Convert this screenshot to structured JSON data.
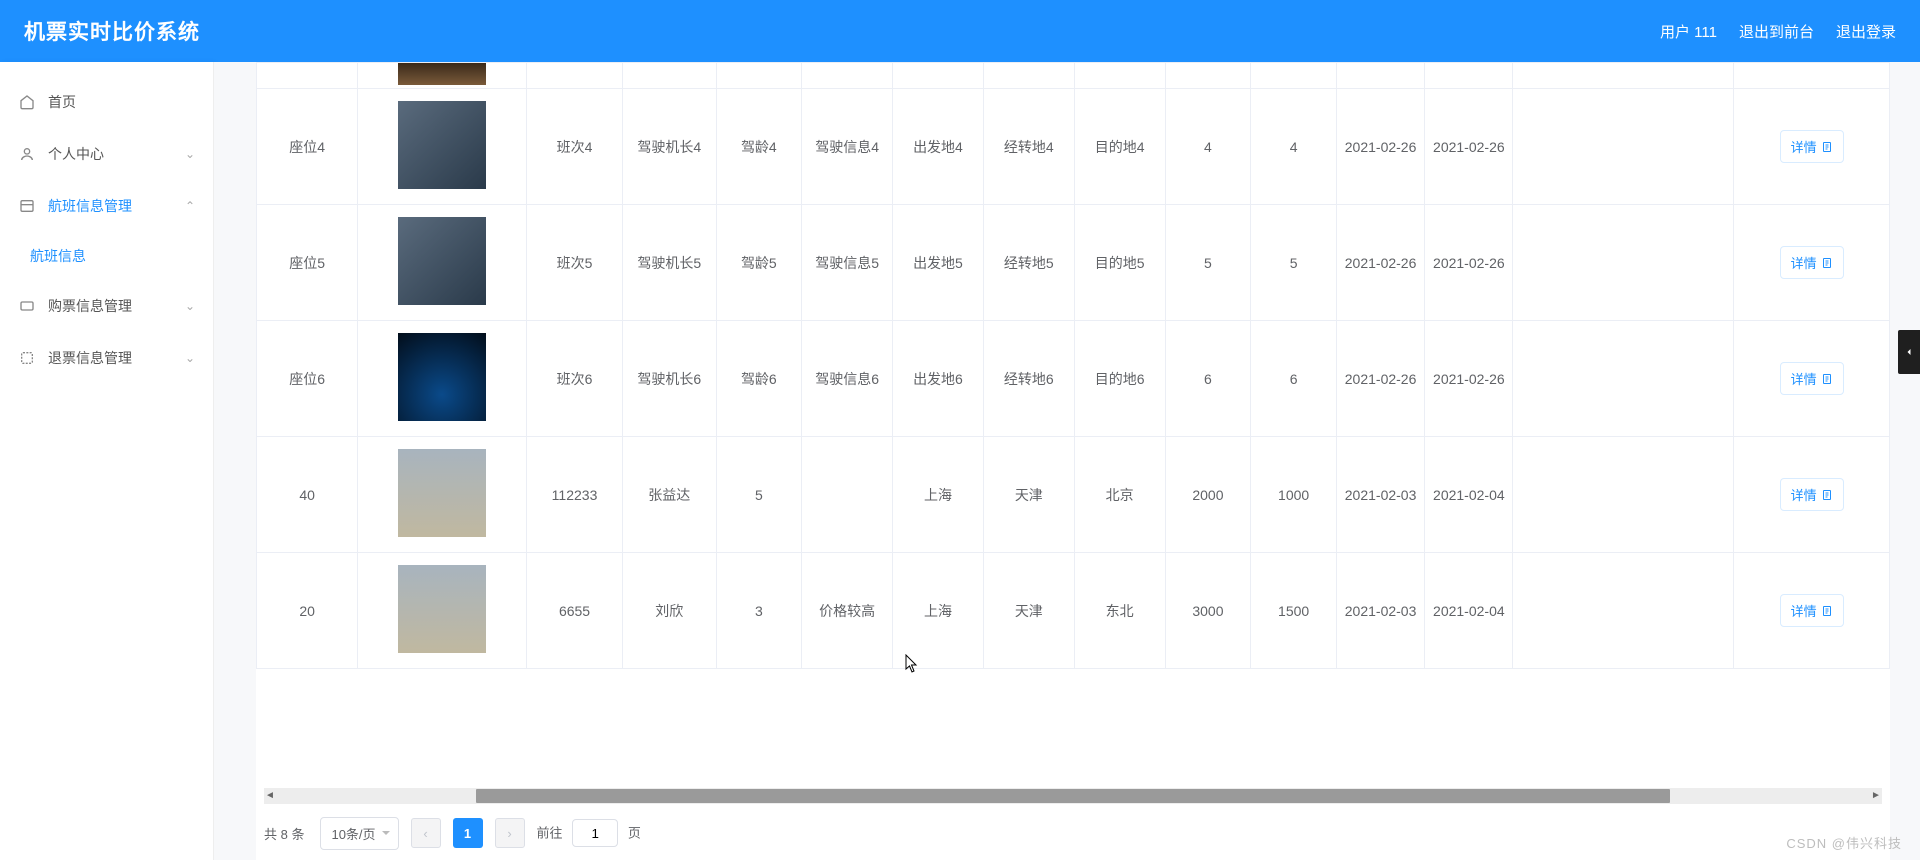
{
  "header": {
    "logo": "机票实时比价系统",
    "user_label": "用户 111",
    "exit_front": "退出到前台",
    "logout": "退出登录"
  },
  "sidebar": {
    "home": "首页",
    "personal": "个人中心",
    "flight_mgmt": "航班信息管理",
    "flight_info": "航班信息",
    "ticket_mgmt": "购票信息管理",
    "refund_mgmt": "退票信息管理"
  },
  "table": {
    "detail_label": "详情",
    "rows": [
      {
        "seat": "座位4",
        "thumb": "rocket",
        "flight": "班次4",
        "pilot": "驾驶机长4",
        "exp": "驾龄4",
        "info": "驾驶信息4",
        "dep": "出发地4",
        "via": "经转地4",
        "dst": "目的地4",
        "n1": "4",
        "n2": "4",
        "d1": "2021-02-26",
        "d2": "2021-02-26"
      },
      {
        "seat": "座位5",
        "thumb": "rocket",
        "flight": "班次5",
        "pilot": "驾驶机长5",
        "exp": "驾龄5",
        "info": "驾驶信息5",
        "dep": "出发地5",
        "via": "经转地5",
        "dst": "目的地5",
        "n1": "5",
        "n2": "5",
        "d1": "2021-02-26",
        "d2": "2021-02-26"
      },
      {
        "seat": "座位6",
        "thumb": "poster",
        "flight": "班次6",
        "pilot": "驾驶机长6",
        "exp": "驾龄6",
        "info": "驾驶信息6",
        "dep": "出发地6",
        "via": "经转地6",
        "dst": "目的地6",
        "n1": "6",
        "n2": "6",
        "d1": "2021-02-26",
        "d2": "2021-02-26"
      },
      {
        "seat": "40",
        "thumb": "plane",
        "flight": "112233",
        "pilot": "张益达",
        "exp": "5",
        "info": "",
        "dep": "上海",
        "via": "天津",
        "dst": "北京",
        "n1": "2000",
        "n2": "1000",
        "d1": "2021-02-03",
        "d2": "2021-02-04"
      },
      {
        "seat": "20",
        "thumb": "plane",
        "flight": "6655",
        "pilot": "刘欣",
        "exp": "3",
        "info": "价格较高",
        "dep": "上海",
        "via": "天津",
        "dst": "东北",
        "n1": "3000",
        "n2": "1500",
        "d1": "2021-02-03",
        "d2": "2021-02-04"
      }
    ],
    "partial_top": {
      "thumb": "sunset"
    }
  },
  "pager": {
    "total": "共 8 条",
    "page_size": "10条/页",
    "current": "1",
    "goto_prefix": "前往",
    "goto_value": "1",
    "goto_suffix": "页"
  },
  "watermark": "CSDN @伟兴科技"
}
